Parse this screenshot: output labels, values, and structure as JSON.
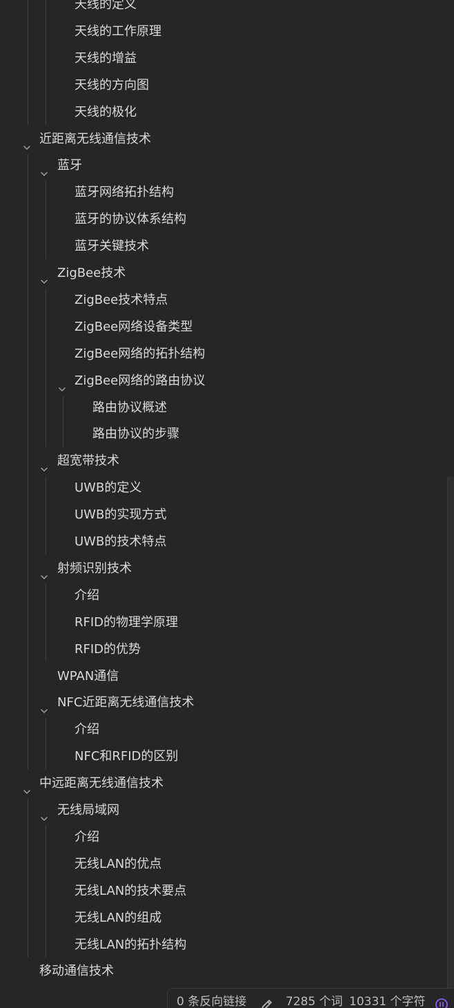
{
  "outline": [
    {
      "label": "天线的定义",
      "level": 3,
      "expanded": false
    },
    {
      "label": "天线的工作原理",
      "level": 3,
      "expanded": false
    },
    {
      "label": "天线的增益",
      "level": 3,
      "expanded": false
    },
    {
      "label": "天线的方向图",
      "level": 3,
      "expanded": false
    },
    {
      "label": "天线的极化",
      "level": 3,
      "expanded": false
    },
    {
      "label": "近距离无线通信技术",
      "level": 1,
      "expanded": true
    },
    {
      "label": "蓝牙",
      "level": 2,
      "expanded": true
    },
    {
      "label": "蓝牙网络拓扑结构",
      "level": 3,
      "expanded": false
    },
    {
      "label": "蓝牙的协议体系结构",
      "level": 3,
      "expanded": false
    },
    {
      "label": "蓝牙关键技术",
      "level": 3,
      "expanded": false
    },
    {
      "label": "ZigBee技术",
      "level": 2,
      "expanded": true
    },
    {
      "label": "ZigBee技术特点",
      "level": 3,
      "expanded": false
    },
    {
      "label": "ZigBee网络设备类型",
      "level": 3,
      "expanded": false
    },
    {
      "label": "ZigBee网络的拓扑结构",
      "level": 3,
      "expanded": false
    },
    {
      "label": "ZigBee网络的路由协议",
      "level": 3,
      "expanded": true
    },
    {
      "label": "路由协议概述",
      "level": 4,
      "expanded": false
    },
    {
      "label": "路由协议的步骤",
      "level": 4,
      "expanded": false
    },
    {
      "label": "超宽带技术",
      "level": 2,
      "expanded": true
    },
    {
      "label": "UWB的定义",
      "level": 3,
      "expanded": false
    },
    {
      "label": "UWB的实现方式",
      "level": 3,
      "expanded": false
    },
    {
      "label": "UWB的技术特点",
      "level": 3,
      "expanded": false
    },
    {
      "label": "射频识别技术",
      "level": 2,
      "expanded": true
    },
    {
      "label": "介绍",
      "level": 3,
      "expanded": false
    },
    {
      "label": "RFID的物理学原理",
      "level": 3,
      "expanded": false
    },
    {
      "label": "RFID的优势",
      "level": 3,
      "expanded": false
    },
    {
      "label": "WPAN通信",
      "level": 2,
      "expanded": false
    },
    {
      "label": "NFC近距离无线通信技术",
      "level": 2,
      "expanded": true
    },
    {
      "label": "介绍",
      "level": 3,
      "expanded": false
    },
    {
      "label": "NFC和RFID的区别",
      "level": 3,
      "expanded": false
    },
    {
      "label": "中远距离无线通信技术",
      "level": 1,
      "expanded": true
    },
    {
      "label": "无线局域网",
      "level": 2,
      "expanded": true
    },
    {
      "label": "介绍",
      "level": 3,
      "expanded": false
    },
    {
      "label": "无线LAN的优点",
      "level": 3,
      "expanded": false
    },
    {
      "label": "无线LAN的技术要点",
      "level": 3,
      "expanded": false
    },
    {
      "label": "无线LAN的组成",
      "level": 3,
      "expanded": false
    },
    {
      "label": "无线LAN的拓扑结构",
      "level": 3,
      "expanded": false
    },
    {
      "label": "移动通信技术",
      "level": 1,
      "expanded": false
    }
  ],
  "statusbar": {
    "backlinks": "0 条反向链接",
    "words": "7285 个词",
    "chars": "10331 个字符",
    "edit_icon": "pencil-icon",
    "sync_icon": "sync-icon"
  },
  "colors": {
    "background": "#262626",
    "text": "#dadada",
    "guide": "#454545",
    "accent": "#8a5cf5"
  }
}
